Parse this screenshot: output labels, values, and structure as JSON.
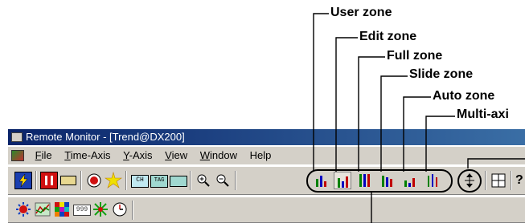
{
  "callouts": {
    "user_zone": "User zone",
    "edit_zone": "Edit zone",
    "full_zone": "Full zone",
    "slide_zone": "Slide zone",
    "auto_zone": "Auto zone",
    "multi_axis": "Multi-axi"
  },
  "window": {
    "title": "Remote Monitor - [Trend@DX200]"
  },
  "menu": {
    "file": {
      "key": "F",
      "rest": "ile"
    },
    "time_axis": {
      "key": "T",
      "rest": "ime-Axis"
    },
    "y_axis": {
      "key": "Y",
      "rest": "-Axis"
    },
    "view": {
      "key": "V",
      "rest": "iew"
    },
    "window": {
      "key": "W",
      "rest": "indow"
    },
    "help": {
      "key": "",
      "rest": "Help"
    }
  },
  "toolbar_icons": {
    "row1": [
      "lightning-icon",
      "stop-icon",
      "tape-icon",
      "record-icon",
      "sparkle-icon",
      "ch-icon",
      "tag-icon",
      "tag-small-icon",
      "zoom-in-icon",
      "zoom-out-icon",
      "user-zone-icon",
      "edit-zone-icon",
      "full-zone-icon",
      "slide-zone-icon",
      "auto-zone-icon",
      "multi-axis-icon",
      "expand-axis-icon",
      "grid-icon",
      "help-icon"
    ],
    "row2": [
      "alarm-icon",
      "chart-icon",
      "color-icon",
      "digital-icon",
      "star-icon",
      "clock-icon"
    ],
    "labels": {
      "ch": "CH",
      "tag": "TAG",
      "digital": "999"
    }
  },
  "colors": {
    "face": "#d4d0c8",
    "titlebar_start": "#0a246a",
    "titlebar_end": "#3a6ea5"
  }
}
